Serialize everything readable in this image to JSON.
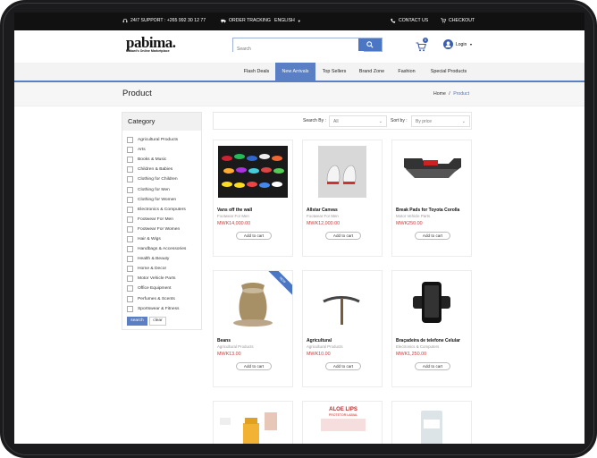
{
  "topbar": {
    "support": "24/7 SUPPORT : +265 992 30 12 77",
    "tracking": "ORDER TRACKING",
    "language": "ENGLISH",
    "contact": "CONTACT US",
    "checkout": "CHECKOUT"
  },
  "header": {
    "logo_word": "pabima.",
    "logo_tagline": "Malawi's Online Marketplace",
    "search_placeholder": "Search",
    "cart_count": "0",
    "login_label": "Login"
  },
  "nav": {
    "items": [
      "Flash Deals",
      "New Arrivals",
      "Top Sellers",
      "Brand Zone",
      "Fashion",
      "Special Products"
    ],
    "active": "New Arrivals"
  },
  "page": {
    "title": "Product",
    "breadcrumb_home": "Home",
    "breadcrumb_sep": "/",
    "breadcrumb_current": "Product"
  },
  "sidebar": {
    "heading": "Category",
    "categories": [
      "Agricultural Products",
      "Arts",
      "Books & Music",
      "Children & Babies",
      "Clothing for Children",
      "Clothing for Men",
      "Clothing for Women",
      "Electronics & Computers",
      "Footwear For Men",
      "Footwear For Women",
      "Hair & Wigs",
      "Handbags & Accessories",
      "Health & Beauty",
      "Home & Decor",
      "Motor Vehicle Parts",
      "Office Equipment",
      "Perfumes & Scents",
      "Sportswear & Fitness"
    ],
    "search_btn": "search",
    "clear_btn": "clear"
  },
  "sortbar": {
    "search_by_label": "Search By :",
    "search_by_value": "All",
    "sort_by_label": "Sort by :",
    "sort_by_value": "By price"
  },
  "products": [
    {
      "name": "Vans off the wall",
      "category": "Footwear For Men",
      "price": "MWK14,000.00",
      "button": "Add to cart",
      "icon": "sneakers-image"
    },
    {
      "name": "Allstar Canvas",
      "category": "Footwear For Men",
      "price": "MWK12,000.00",
      "button": "Add to cart",
      "icon": "white-sneakers-image"
    },
    {
      "name": "Break Pads for Toyota Corolla",
      "category": "Motor Vehicle Parts",
      "price": "MWK250.00",
      "button": "Add to cart",
      "icon": "brake-pads-image"
    },
    {
      "name": "Beans",
      "category": "Agricultural Products",
      "price": "MWK13.00",
      "button": "Add to cart",
      "icon": "beans-sack-image",
      "ribbon": "NEW"
    },
    {
      "name": "Agricultural",
      "category": "Agricultural Products",
      "price": "MWK10.00",
      "button": "Add to cart",
      "icon": "pickaxe-image"
    },
    {
      "name": "Braçadeira de telefone Celular",
      "category": "Electronics & Computers",
      "price": "MWK1,250.00",
      "button": "Add to cart",
      "icon": "phone-armband-image"
    }
  ],
  "partial_products": [
    {
      "icon": "aloe-products-image"
    },
    {
      "icon": "aloe-lips-image",
      "title": "ALOE LIPS",
      "subtitle": "PROTETOR LABIAL"
    },
    {
      "icon": "aloe-bottle-image"
    }
  ],
  "colors": {
    "accent": "#5b7fc4",
    "price": "#d23a3a",
    "topbar": "#111111"
  }
}
